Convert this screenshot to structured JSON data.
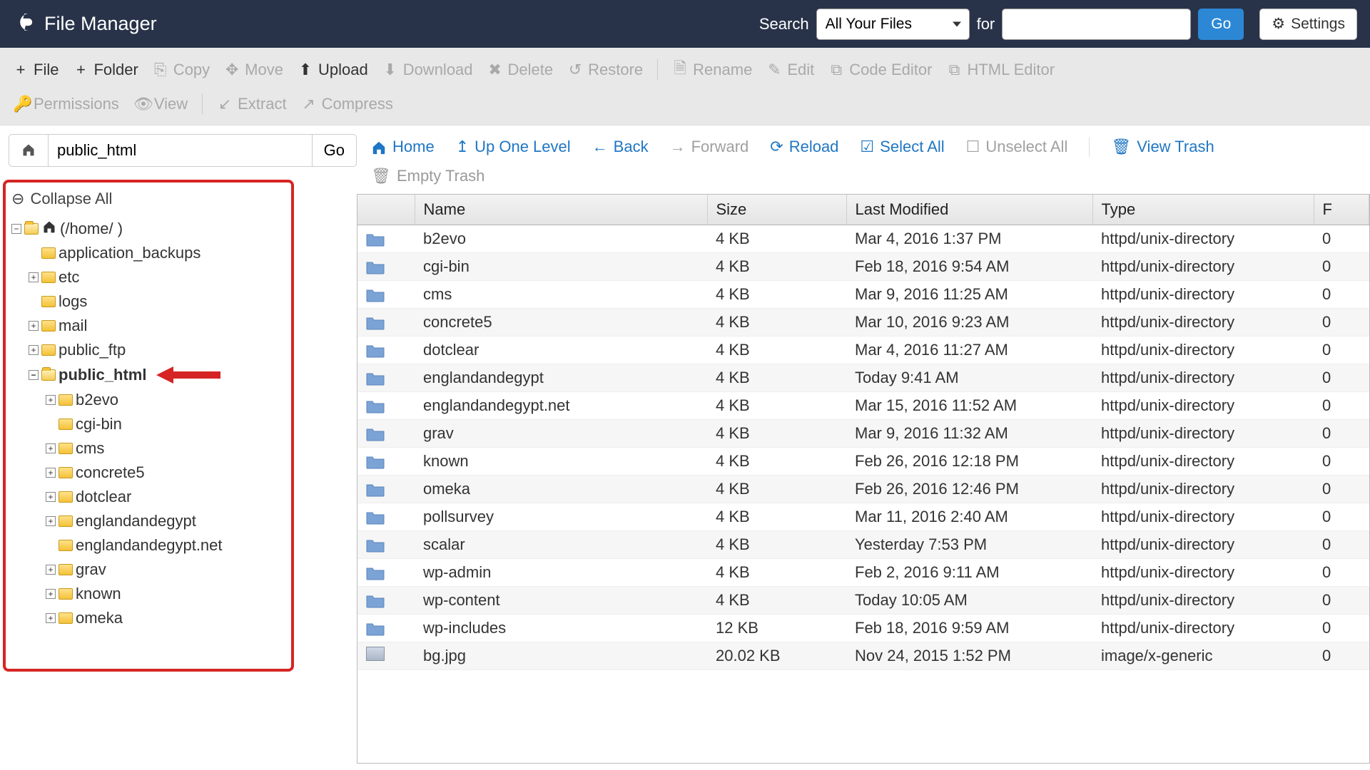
{
  "header": {
    "app_title": "File Manager",
    "search_label": "Search",
    "scope_selected": "All Your Files",
    "for_label": "for",
    "search_query": "",
    "go_label": "Go",
    "settings_label": "Settings"
  },
  "toolbar": {
    "row1": [
      {
        "label": "File",
        "icon": "+",
        "disabled": false
      },
      {
        "label": "Folder",
        "icon": "+",
        "disabled": false
      },
      {
        "label": "Copy",
        "icon": "⎘",
        "disabled": true
      },
      {
        "label": "Move",
        "icon": "✥",
        "disabled": true
      },
      {
        "label": "Upload",
        "icon": "⬆",
        "disabled": false
      },
      {
        "label": "Download",
        "icon": "⬇",
        "disabled": true
      },
      {
        "label": "Delete",
        "icon": "✖",
        "disabled": true
      },
      {
        "label": "Restore",
        "icon": "↺",
        "disabled": true,
        "sep_after": true
      },
      {
        "label": "Rename",
        "icon": "🗎",
        "disabled": true
      },
      {
        "label": "Edit",
        "icon": "✎",
        "disabled": true
      },
      {
        "label": "Code Editor",
        "icon": "⧉",
        "disabled": true
      },
      {
        "label": "HTML Editor",
        "icon": "⧉",
        "disabled": true
      }
    ],
    "row2": [
      {
        "label": "Permissions",
        "icon": "🔑",
        "disabled": true
      },
      {
        "label": "View",
        "icon": "👁",
        "disabled": true,
        "sep_after": true
      },
      {
        "label": "Extract",
        "icon": "↙",
        "disabled": true
      },
      {
        "label": "Compress",
        "icon": "↗",
        "disabled": true
      }
    ]
  },
  "path_bar": {
    "value": "public_html",
    "go_label": "Go"
  },
  "tree": {
    "collapse_label": "Collapse All",
    "root_label": "(/home/           )",
    "root_items": [
      {
        "label": "application_backups",
        "expandable": false
      },
      {
        "label": "etc",
        "expandable": true
      },
      {
        "label": "logs",
        "expandable": false
      },
      {
        "label": "mail",
        "expandable": true
      },
      {
        "label": "public_ftp",
        "expandable": true
      },
      {
        "label": "public_html",
        "expandable": true,
        "expanded": true,
        "bold": true,
        "arrow": true
      }
    ],
    "public_html_children": [
      {
        "label": "b2evo",
        "expandable": true
      },
      {
        "label": "cgi-bin",
        "expandable": false
      },
      {
        "label": "cms",
        "expandable": true
      },
      {
        "label": "concrete5",
        "expandable": true
      },
      {
        "label": "dotclear",
        "expandable": true
      },
      {
        "label": "englandandegypt",
        "expandable": true
      },
      {
        "label": "englandandegypt.net",
        "expandable": false
      },
      {
        "label": "grav",
        "expandable": true
      },
      {
        "label": "known",
        "expandable": true
      },
      {
        "label": "omeka",
        "expandable": true
      }
    ]
  },
  "nav": {
    "home": "Home",
    "up": "Up One Level",
    "back": "Back",
    "forward": "Forward",
    "reload": "Reload",
    "select_all": "Select All",
    "unselect_all": "Unselect All",
    "view_trash": "View Trash",
    "empty_trash": "Empty Trash"
  },
  "columns": {
    "name": "Name",
    "size": "Size",
    "modified": "Last Modified",
    "type": "Type"
  },
  "files": [
    {
      "name": "b2evo",
      "size": "4 KB",
      "modified": "Mar 4, 2016 1:37 PM",
      "type": "httpd/unix-directory",
      "perm": "0",
      "kind": "folder"
    },
    {
      "name": "cgi-bin",
      "size": "4 KB",
      "modified": "Feb 18, 2016 9:54 AM",
      "type": "httpd/unix-directory",
      "perm": "0",
      "kind": "folder"
    },
    {
      "name": "cms",
      "size": "4 KB",
      "modified": "Mar 9, 2016 11:25 AM",
      "type": "httpd/unix-directory",
      "perm": "0",
      "kind": "folder"
    },
    {
      "name": "concrete5",
      "size": "4 KB",
      "modified": "Mar 10, 2016 9:23 AM",
      "type": "httpd/unix-directory",
      "perm": "0",
      "kind": "folder"
    },
    {
      "name": "dotclear",
      "size": "4 KB",
      "modified": "Mar 4, 2016 11:27 AM",
      "type": "httpd/unix-directory",
      "perm": "0",
      "kind": "folder"
    },
    {
      "name": "englandandegypt",
      "size": "4 KB",
      "modified": "Today 9:41 AM",
      "type": "httpd/unix-directory",
      "perm": "0",
      "kind": "folder"
    },
    {
      "name": "englandandegypt.net",
      "size": "4 KB",
      "modified": "Mar 15, 2016 11:52 AM",
      "type": "httpd/unix-directory",
      "perm": "0",
      "kind": "folder"
    },
    {
      "name": "grav",
      "size": "4 KB",
      "modified": "Mar 9, 2016 11:32 AM",
      "type": "httpd/unix-directory",
      "perm": "0",
      "kind": "folder"
    },
    {
      "name": "known",
      "size": "4 KB",
      "modified": "Feb 26, 2016 12:18 PM",
      "type": "httpd/unix-directory",
      "perm": "0",
      "kind": "folder"
    },
    {
      "name": "omeka",
      "size": "4 KB",
      "modified": "Feb 26, 2016 12:46 PM",
      "type": "httpd/unix-directory",
      "perm": "0",
      "kind": "folder"
    },
    {
      "name": "pollsurvey",
      "size": "4 KB",
      "modified": "Mar 11, 2016 2:40 AM",
      "type": "httpd/unix-directory",
      "perm": "0",
      "kind": "folder"
    },
    {
      "name": "scalar",
      "size": "4 KB",
      "modified": "Yesterday 7:53 PM",
      "type": "httpd/unix-directory",
      "perm": "0",
      "kind": "folder"
    },
    {
      "name": "wp-admin",
      "size": "4 KB",
      "modified": "Feb 2, 2016 9:11 AM",
      "type": "httpd/unix-directory",
      "perm": "0",
      "kind": "folder"
    },
    {
      "name": "wp-content",
      "size": "4 KB",
      "modified": "Today 10:05 AM",
      "type": "httpd/unix-directory",
      "perm": "0",
      "kind": "folder"
    },
    {
      "name": "wp-includes",
      "size": "12 KB",
      "modified": "Feb 18, 2016 9:59 AM",
      "type": "httpd/unix-directory",
      "perm": "0",
      "kind": "folder"
    },
    {
      "name": "bg.jpg",
      "size": "20.02 KB",
      "modified": "Nov 24, 2015 1:52 PM",
      "type": "image/x-generic",
      "perm": "0",
      "kind": "image"
    }
  ]
}
